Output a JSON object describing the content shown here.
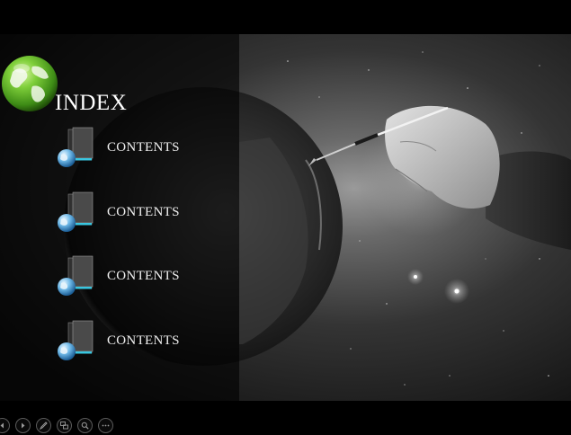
{
  "slide": {
    "title": "INDEX",
    "items": [
      {
        "label": "CONTENTS"
      },
      {
        "label": "CONTENTS"
      },
      {
        "label": "CONTENTS"
      },
      {
        "label": "CONTENTS"
      }
    ]
  },
  "toolbar": {
    "buttons": [
      {
        "icon": "previous-icon"
      },
      {
        "icon": "next-icon"
      },
      {
        "icon": "pen-icon"
      },
      {
        "icon": "slides-icon"
      },
      {
        "icon": "zoom-icon"
      },
      {
        "icon": "more-icon"
      }
    ]
  },
  "colors": {
    "background": "#000000",
    "globe_green": "#5fb82e",
    "folder_accent": "#39c6e0",
    "text": "#ffffff"
  }
}
